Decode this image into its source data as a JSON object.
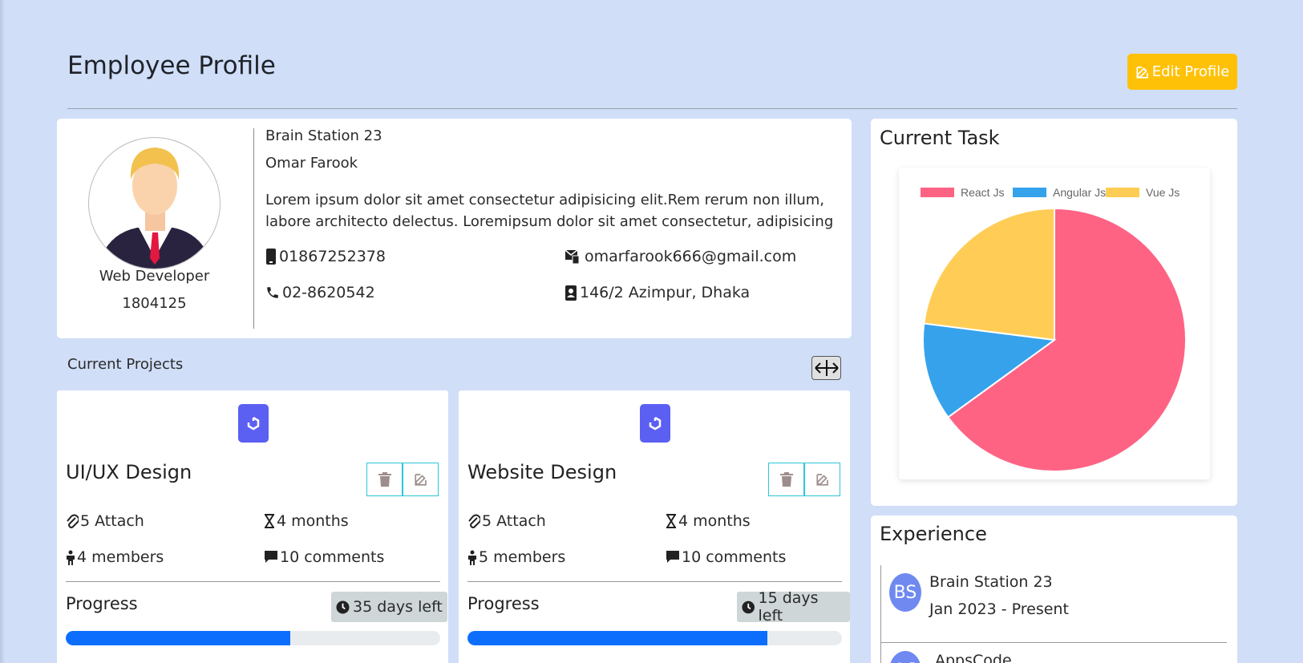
{
  "page": {
    "title": "Employee Profile",
    "edit_label": "Edit Profile"
  },
  "profile": {
    "company": "Brain Station 23",
    "name": "Omar Farook",
    "description": "Lorem ipsum dolor sit amet consectetur adipisicing elit.Rem rerum non illum, labore architecto delectus. Loremipsum dolor sit amet consectetur, adipisicing",
    "role": "Web Developer",
    "employee_id": "1804125",
    "mobile": "01867252378",
    "email": "omarfarook666@gmail.com",
    "phone": "02-8620542",
    "address": "146/2 Azimpur, Dhaka"
  },
  "projects_section": {
    "title": "Current Projects"
  },
  "projects": [
    {
      "name": "UI/UX Design",
      "attach": "5 Attach",
      "duration": "4 months",
      "members": "4 members",
      "comments": "10 comments",
      "progress_label": "Progress",
      "days_left": "35 days left",
      "progress": 0.6
    },
    {
      "name": "Website Design",
      "attach": "5 Attach",
      "duration": "4 months",
      "members": "5 members",
      "comments": "10 comments",
      "progress_label": "Progress",
      "days_left": "15 days left",
      "progress": 0.8
    }
  ],
  "task": {
    "title": "Current Task"
  },
  "chart_data": {
    "type": "pie",
    "categories": [
      "React Js",
      "Angular Js",
      "Vue Js"
    ],
    "values": [
      65,
      12,
      23
    ],
    "colors": [
      "#ff6384",
      "#36a2eb",
      "#ffcd56"
    ],
    "legend": "top"
  },
  "experience": {
    "title": "Experience",
    "items": [
      {
        "initials": "BS",
        "company": "Brain Station 23",
        "period": "Jan 2023 - Present"
      },
      {
        "initials": "AC",
        "company": "AppsCode"
      }
    ]
  },
  "colors": {
    "accent": "#ffc107",
    "primary": "#0d6efd",
    "project_logo": "#5b5ff2",
    "background": "#d0def8"
  }
}
